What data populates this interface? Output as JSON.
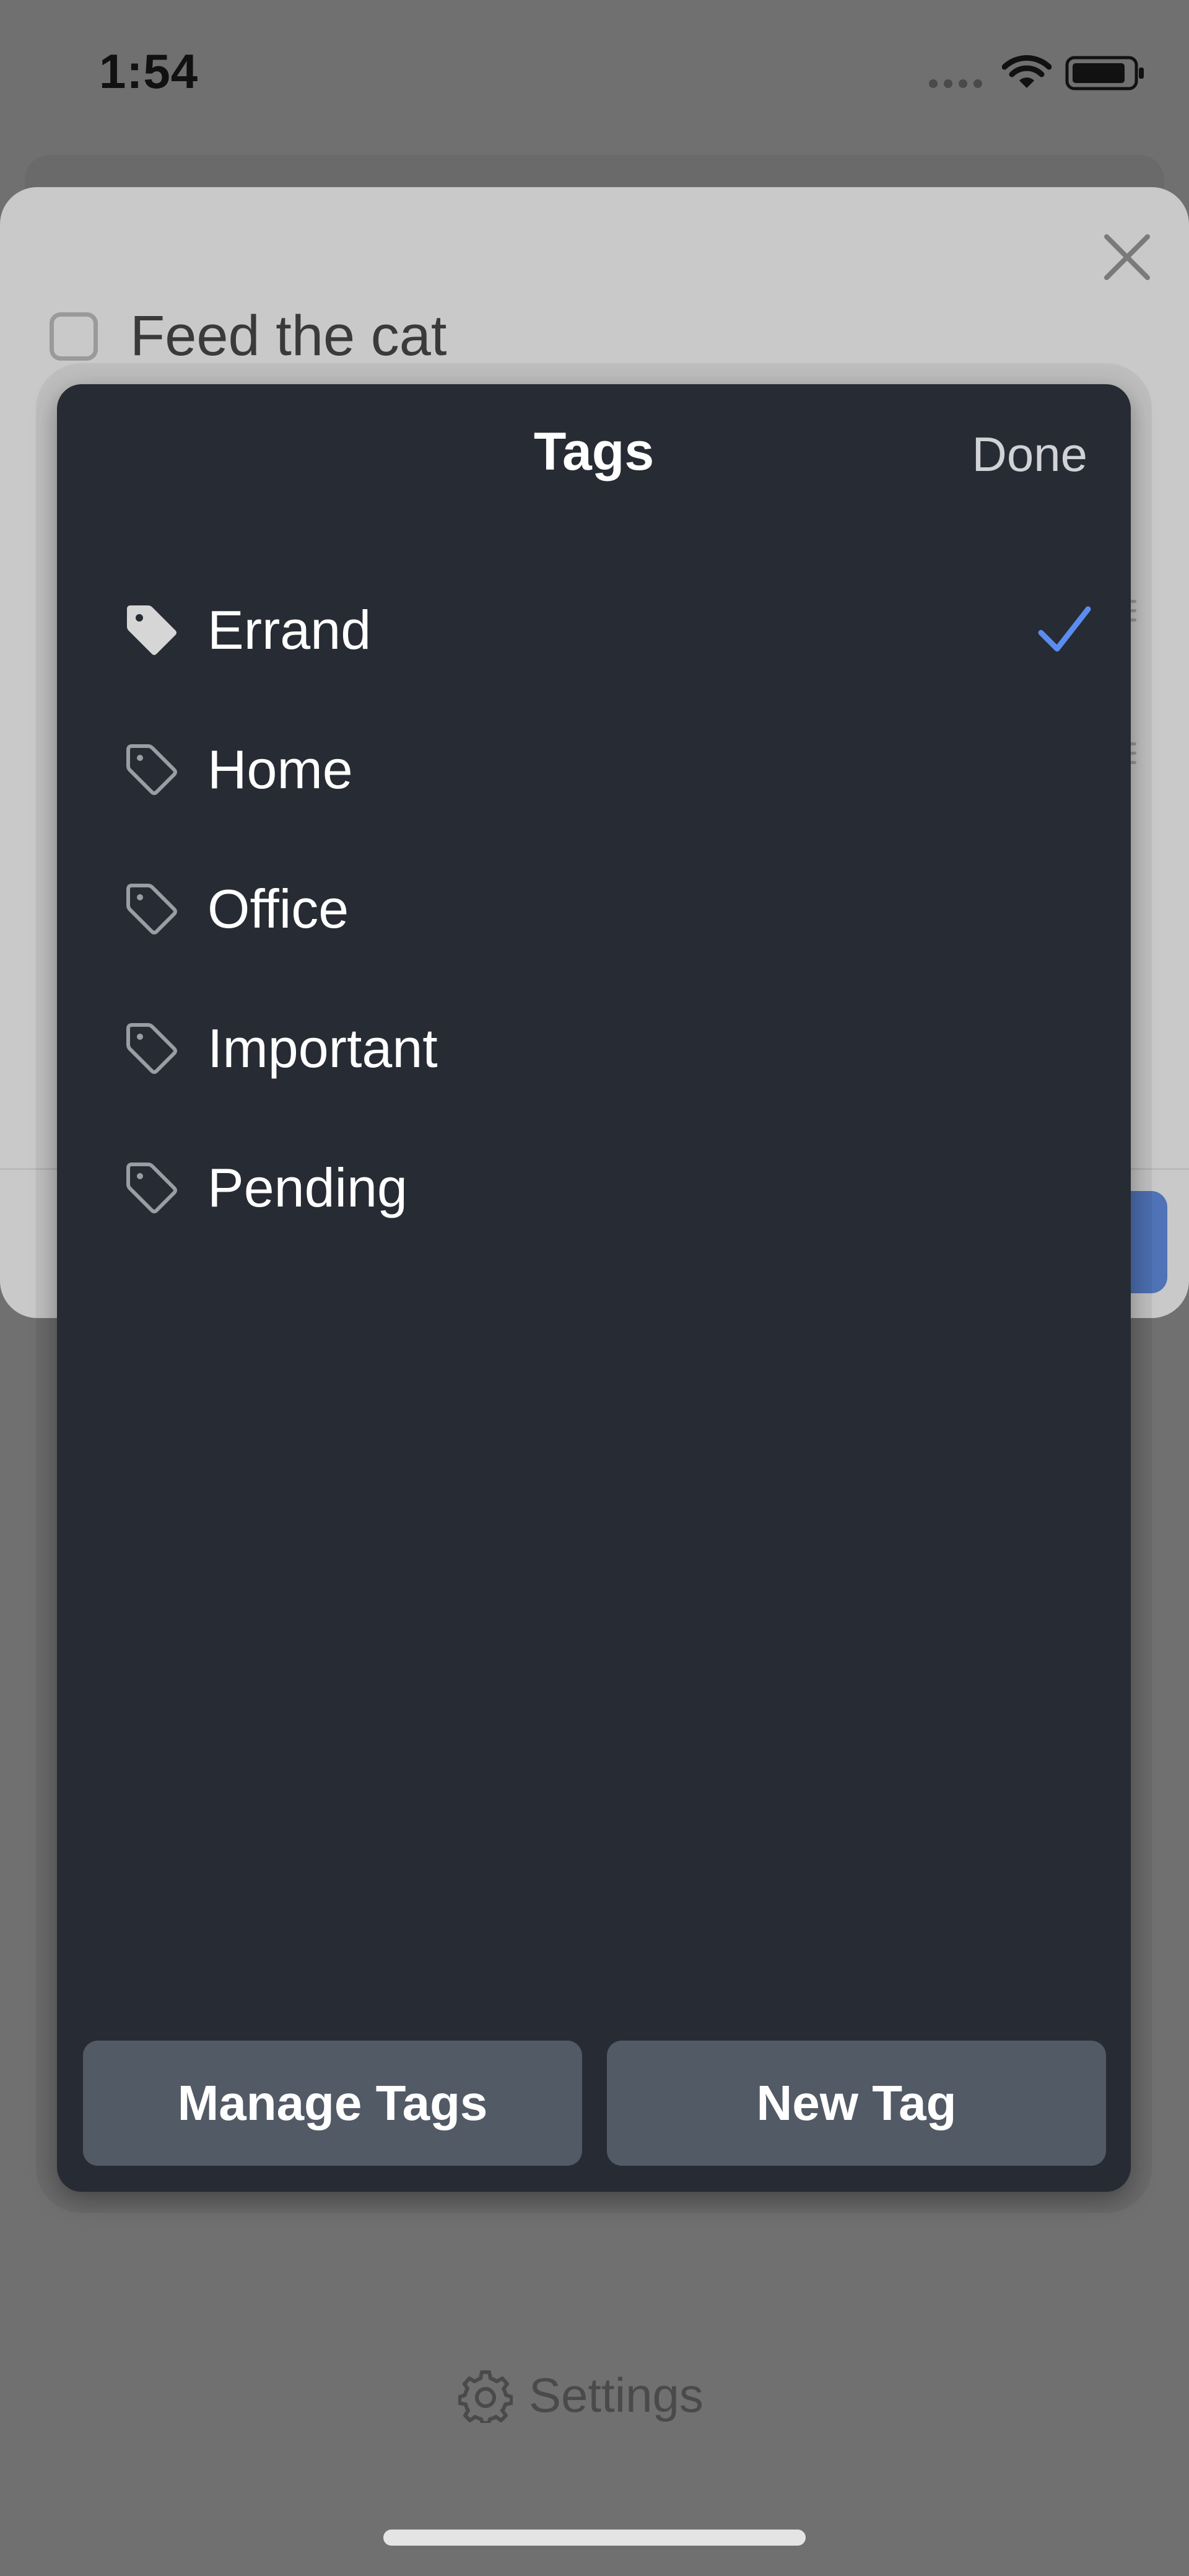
{
  "status_bar": {
    "time": "1:54"
  },
  "task": {
    "title": "Feed the cat"
  },
  "tags_panel": {
    "title": "Tags",
    "done_label": "Done",
    "items": [
      {
        "label": "Errand",
        "selected": true
      },
      {
        "label": "Home",
        "selected": false
      },
      {
        "label": "Office",
        "selected": false
      },
      {
        "label": "Important",
        "selected": false
      },
      {
        "label": "Pending",
        "selected": false
      }
    ],
    "manage_tags_label": "Manage Tags",
    "new_tag_label": "New Tag"
  },
  "bottom_bar": {
    "settings_label": "Settings"
  },
  "colors": {
    "backdrop": "#707070",
    "panel_bg": "#272b33",
    "button_bg": "#525a66",
    "check_accent": "#5b8def"
  },
  "icons": {
    "selected_tag": "tag-filled-icon",
    "unselected_tag": "tag-outline-icon",
    "check": "checkmark-icon",
    "close": "close-icon",
    "settings": "gear-icon"
  }
}
